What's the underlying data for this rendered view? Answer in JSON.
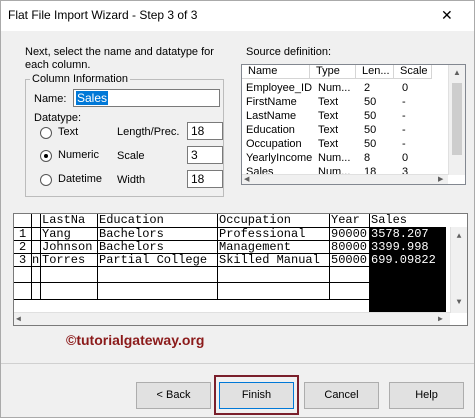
{
  "window": {
    "title": "Flat File Import Wizard - Step 3 of 3",
    "close_glyph": "✕"
  },
  "instructions": "Next, select the name and datatype for each column.",
  "column_info": {
    "legend": "Column Information",
    "name_label": "Name:",
    "name_value": "Sales",
    "datatype_label": "Datatype:",
    "options": [
      {
        "label": "Text",
        "selected": false
      },
      {
        "label": "Numeric",
        "selected": true
      },
      {
        "label": "Datetime",
        "selected": false
      }
    ],
    "length_label": "Length/Prec.",
    "length_value": "18",
    "scale_label": "Scale",
    "scale_value": "3",
    "width_label": "Width",
    "width_value": "18"
  },
  "source_definition": {
    "label": "Source definition:",
    "headers": [
      "Name",
      "Type",
      "Len...",
      "Scale"
    ],
    "rows": [
      [
        "Employee_ID",
        "Num...",
        "2",
        "0"
      ],
      [
        "FirstName",
        "Text",
        "50",
        "-"
      ],
      [
        "LastName",
        "Text",
        "50",
        "-"
      ],
      [
        "Education",
        "Text",
        "50",
        "-"
      ],
      [
        "Occupation",
        "Text",
        "50",
        "-"
      ],
      [
        "YearlyIncome",
        "Num...",
        "8",
        "0"
      ],
      [
        "Sales",
        "Num...",
        "18",
        "3"
      ]
    ]
  },
  "preview": {
    "headers": [
      "LastNa",
      "Education",
      "Occupation",
      "Year",
      "Sales"
    ],
    "row_numbers": [
      "1",
      "2",
      "3"
    ],
    "row_marker": "n",
    "rows": [
      [
        "Yang",
        "Bachelors",
        "Professional",
        "90000",
        "3578.207"
      ],
      [
        "Johnson",
        "Bachelors",
        "Management",
        "80000",
        "3399.998"
      ],
      [
        "Torres",
        "Partial College",
        "Skilled Manual",
        "50000",
        "699.09822"
      ]
    ]
  },
  "branding": "©tutorialgateway.org",
  "buttons": {
    "back": "< Back",
    "finish": "Finish",
    "cancel": "Cancel",
    "help": "Help"
  },
  "colors": {
    "selection": "#0078d7",
    "highlight_column": "#000000",
    "annotation": "#8b1a1a"
  }
}
